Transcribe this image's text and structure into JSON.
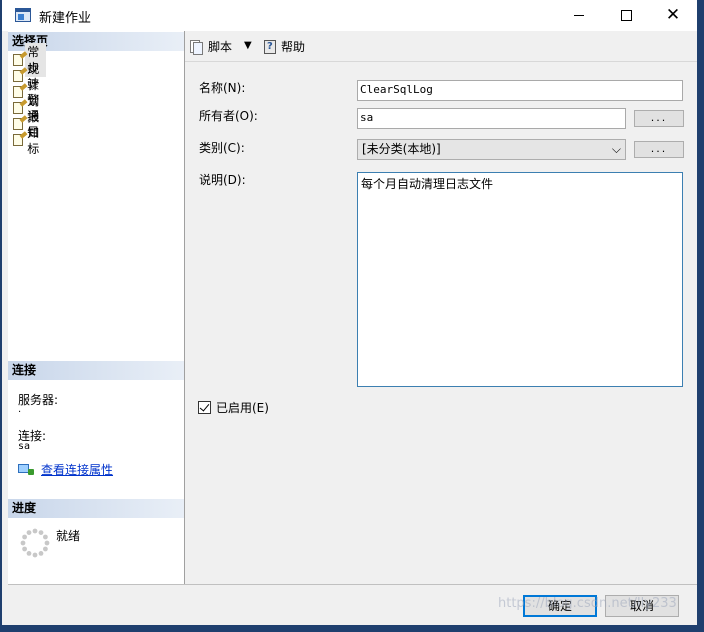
{
  "window": {
    "title": "新建作业"
  },
  "sidebar": {
    "pages_header": "选择页",
    "items": [
      {
        "label": "常规",
        "selected": true
      },
      {
        "label": "步骤"
      },
      {
        "label": "计划"
      },
      {
        "label": "警报"
      },
      {
        "label": "通知"
      },
      {
        "label": "目标"
      }
    ],
    "connection": {
      "header": "连接",
      "server_label": "服务器:",
      "server_value": ".",
      "connection_label": "连接:",
      "connection_value": "sa",
      "view_link": "查看连接属性"
    },
    "progress": {
      "header": "进度",
      "status": "就绪"
    }
  },
  "toolbar": {
    "script_label": "脚本",
    "help_label": "帮助"
  },
  "form": {
    "name_label": "名称(N):",
    "name_value": "ClearSqlLog",
    "owner_label": "所有者(O):",
    "owner_value": "sa",
    "browse_label": "...",
    "category_label": "类别(C):",
    "category_value": "[未分类(本地)]",
    "description_label": "说明(D):",
    "description_value": "每个月自动清理日志文件",
    "enabled_label": "已启用(E)",
    "enabled_checked": true
  },
  "footer": {
    "ok_label": "确定",
    "cancel_label": "取消"
  },
  "watermark": "https://blog.csdn.net/lly233",
  "colors": {
    "accent": "#0078d7",
    "link": "#0033cc",
    "header_gradient_start": "#c8d6ea"
  }
}
